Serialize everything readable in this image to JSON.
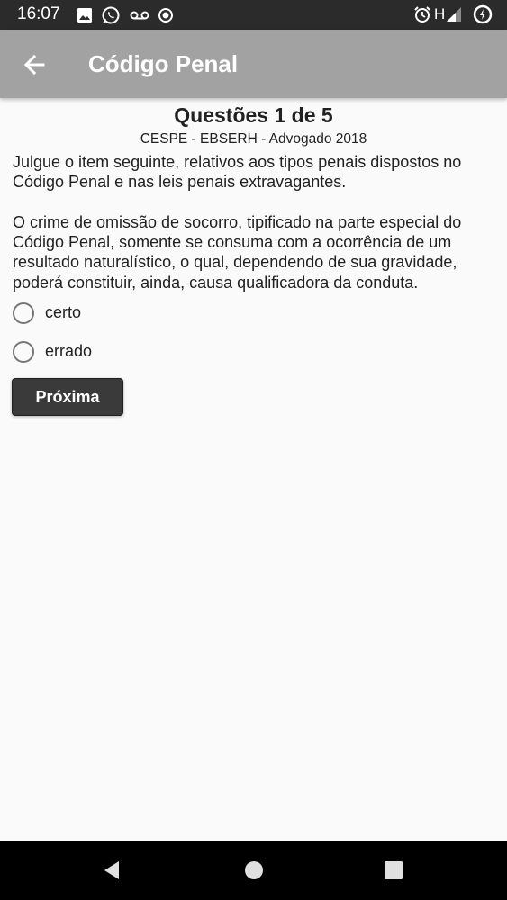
{
  "status_bar": {
    "time": "16:07",
    "network_label": "H",
    "left_icons": [
      "gallery-icon",
      "whatsapp-icon",
      "voicemail-icon",
      "record-icon"
    ],
    "right_icons": [
      "alarm-icon",
      "signal-icon",
      "battery-icon"
    ]
  },
  "app_bar": {
    "title": "Código Penal",
    "back_icon": "arrow-left-icon"
  },
  "question": {
    "title": "Questões 1 de 5",
    "source": "CESPE - EBSERH - Advogado 2018",
    "text": "Julgue o item seguinte, relativos aos tipos penais dispostos no Código Penal e nas leis penais extravagantes.\n\nO crime de omissão de socorro, tipificado na parte especial do Código Penal, somente se consuma com a ocorrência de um resultado naturalístico, o qual, dependendo de sua gravidade, poderá constituir, ainda, causa qualificadora da conduta."
  },
  "options": [
    {
      "label": "certo",
      "selected": false
    },
    {
      "label": "errado",
      "selected": false
    }
  ],
  "next_button": {
    "label": "Próxima"
  },
  "nav_bar": {
    "icons": [
      "back-triangle-icon",
      "home-circle-icon",
      "recents-square-icon"
    ]
  },
  "colors": {
    "status_bar": "#2b2b2b",
    "app_bar": "#a2a2a2",
    "background": "#fafafa",
    "button": "#3a3a3a",
    "nav_bar": "#000000"
  }
}
